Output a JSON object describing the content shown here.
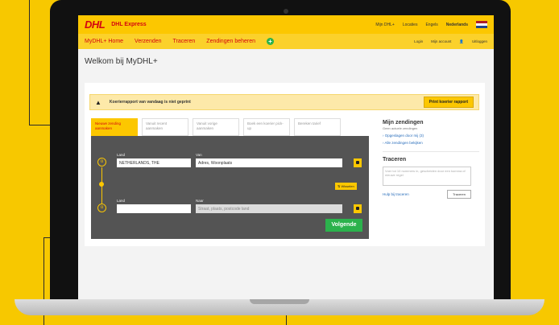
{
  "header": {
    "logo": "DHL",
    "product": "DHL Express",
    "links": [
      "Mijn DHL+",
      "Locaties",
      "Engels",
      "Nederlands"
    ]
  },
  "nav": {
    "items": [
      "MyDHL+ Home",
      "Verzenden",
      "Traceren",
      "Zendingen beheren"
    ],
    "right": [
      "Login",
      "Mijn account",
      "Uitloggen"
    ]
  },
  "page": {
    "title": "Welkom bij MyDHL+"
  },
  "alert": {
    "text": "Koerierrapport van vandaag is niet geprint",
    "button": "Print koerier rapport"
  },
  "tabs": [
    "Nieuwe zending aanmaken",
    "Vanuit recent aanmaken",
    "Vanuit vorige aanmaken",
    "Boek een koerier pick-up",
    "Bereken tarief"
  ],
  "form": {
    "from_label": "Land",
    "from_country": "NETHERLANDS, THE",
    "from_city_label": "Van",
    "from_city": "Adres, Woonplaats",
    "swap": "⇅ Wisselen",
    "to_label": "Land",
    "to_country": "",
    "to_city_label": "Naar",
    "to_city_placeholder": "Straat, plaats, postcode land",
    "next": "Volgende"
  },
  "sidebar": {
    "shipments_title": "Mijn zendingen",
    "shipments_sub": "Geen actuele zendingen",
    "link1": "› Opgeslagen door mij (3)",
    "link2": "› Alle zendingen bekijken",
    "track_title": "Traceren",
    "track_placeholder": "Voer tot 10 nummers in, gescheiden door een komma of nieuwe regel",
    "track_link": "Hulp bij traceren",
    "track_button": "Traceren"
  }
}
